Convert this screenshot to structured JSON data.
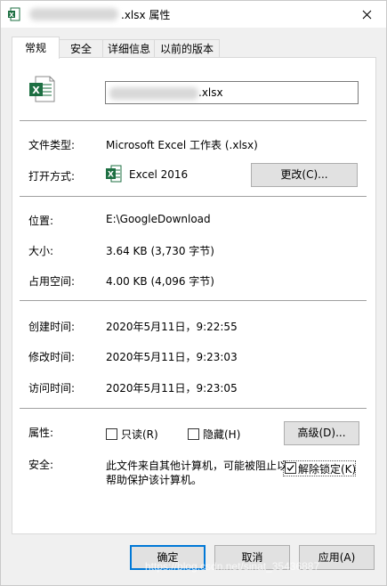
{
  "window": {
    "title_suffix": ".xlsx 属性"
  },
  "tabs": [
    {
      "label": "常规"
    },
    {
      "label": "安全"
    },
    {
      "label": "详细信息"
    },
    {
      "label": "以前的版本"
    }
  ],
  "general": {
    "filename_suffix": ".xlsx",
    "file_type_label": "文件类型:",
    "file_type_value": "Microsoft Excel 工作表 (.xlsx)",
    "open_with_label": "打开方式:",
    "open_with_value": "Excel 2016",
    "change_button": "更改(C)...",
    "location_label": "位置:",
    "location_value": "E:\\GoogleDownload",
    "size_label": "大小:",
    "size_value": "3.64 KB (3,730 字节)",
    "size_on_disk_label": "占用空间:",
    "size_on_disk_value": "4.00 KB (4,096 字节)",
    "created_label": "创建时间:",
    "created_value": "2020年5月11日，9:22:55",
    "modified_label": "修改时间:",
    "modified_value": "2020年5月11日，9:23:03",
    "accessed_label": "访问时间:",
    "accessed_value": "2020年5月11日，9:23:05",
    "attributes_label": "属性:",
    "readonly_label": "只读(R)",
    "readonly_checked": false,
    "hidden_label": "隐藏(H)",
    "hidden_checked": false,
    "advanced_button": "高级(D)...",
    "security_label": "安全:",
    "security_text": "此文件来自其他计算机，可能被阻止以帮助保护该计算机。",
    "unblock_label": "解除锁定(K)",
    "unblock_checked": true
  },
  "footer": {
    "ok": "确定",
    "cancel": "取消",
    "apply": "应用(A)"
  },
  "watermark": "https://blog.csdn.net/sinat_35436887",
  "colors": {
    "excel_green": "#1d6f42",
    "accent": "#0078d7"
  }
}
